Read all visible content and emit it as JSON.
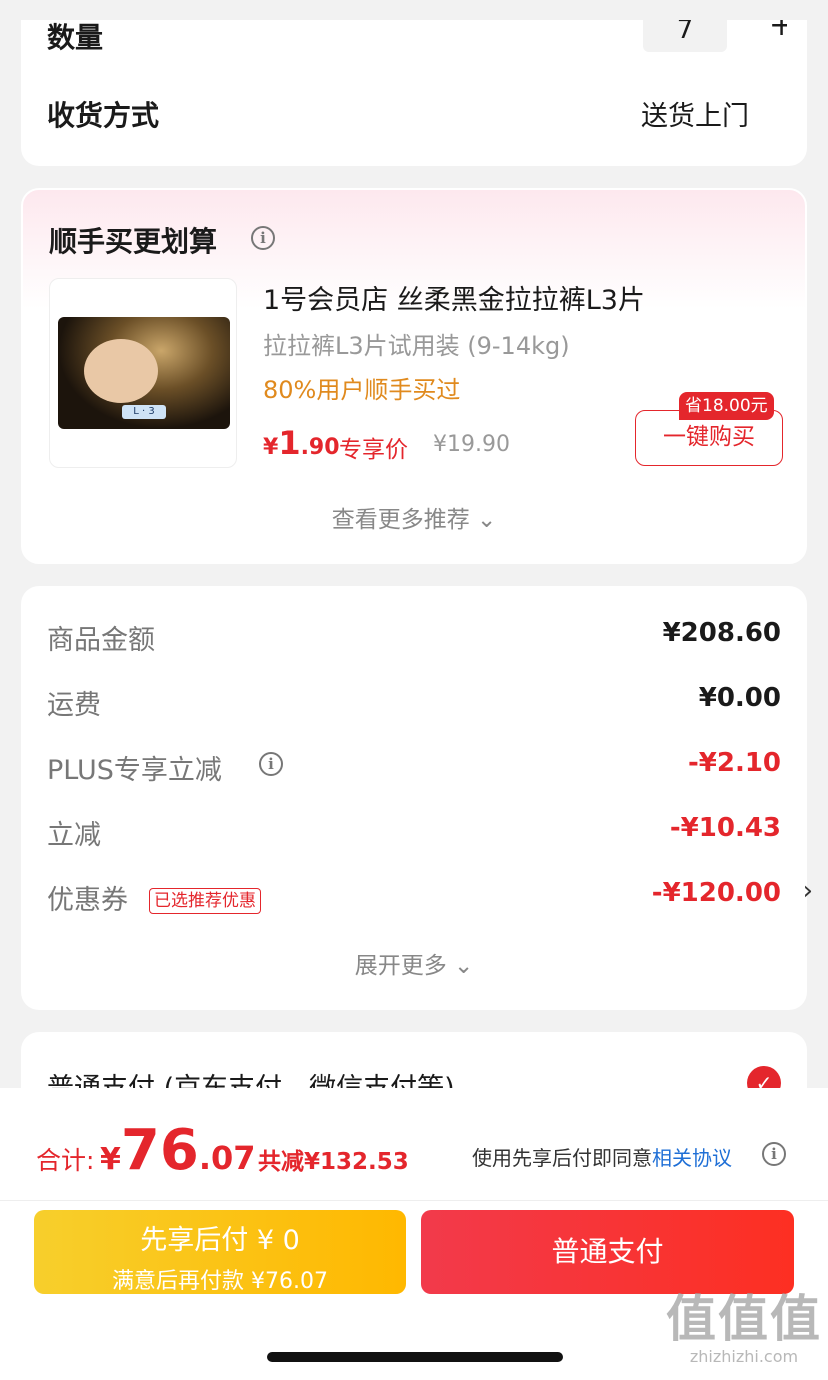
{
  "order": {
    "quantity_label": "数量",
    "quantity_value": "7",
    "quantity_plus": "+",
    "shipping_label": "收货方式",
    "shipping_value": "送货上门"
  },
  "addon": {
    "title": "顺手买更划算",
    "product_name": "1号会员店 丝柔黑金拉拉裤L3片",
    "product_spec": "拉拉裤L3片试用装 (9-14kg)",
    "popularity": "80%用户顺手买过",
    "price_symbol": "¥",
    "price_int": "1",
    "price_dec": ".90",
    "price_tag": "专享价",
    "original_price": "¥19.90",
    "save_badge": "省18.00元",
    "buy_button": "一键购买",
    "more": "查看更多推荐"
  },
  "fees": {
    "rows": [
      {
        "label": "商品金额",
        "value": "¥208.60"
      },
      {
        "label": "运费",
        "value": "¥0.00"
      },
      {
        "label": "PLUS专享立减",
        "value": "-¥2.10"
      },
      {
        "label": "立减",
        "value": "-¥10.43"
      },
      {
        "label": "优惠券",
        "value": "-¥120.00",
        "tag": "已选推荐优惠"
      }
    ],
    "expand": "展开更多"
  },
  "payment": {
    "method_label": "普通支付 (京东支付、微信支付等)"
  },
  "footer": {
    "total_label": "合计:",
    "total_symbol": "¥",
    "total_int": "76",
    "total_dec": ".07",
    "total_saved": "共减¥132.53",
    "agree_text": "使用先享后付即同意",
    "agree_link": "相关协议",
    "pay_later_line1": "先享后付 ¥ 0",
    "pay_later_line2": "满意后再付款 ¥76.07",
    "pay_normal": "普通支付"
  },
  "watermark": {
    "mark": "值值值",
    "site": "zhizhizhi.com"
  },
  "colors": {
    "accent_red": "#e4262c",
    "gold": "#ffb800",
    "link": "#1f6fd6",
    "popularity": "#e08a1e"
  }
}
